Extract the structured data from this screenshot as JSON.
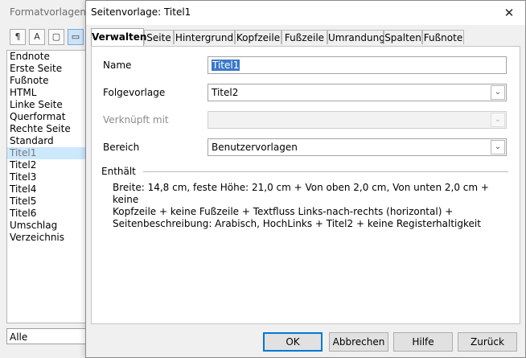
{
  "panel": {
    "title": "Formatvorlagen",
    "items": [
      "Endnote",
      "Erste Seite",
      "Fußnote",
      "HTML",
      "Linke Seite",
      "Querformat",
      "Rechte Seite",
      "Standard",
      "Titel1",
      "Titel2",
      "Titel3",
      "Titel4",
      "Titel5",
      "Titel6",
      "Umschlag",
      "Verzeichnis"
    ],
    "selected_index": 8,
    "filter_value": "Alle"
  },
  "dialog": {
    "title": "Seitenvorlage: Titel1",
    "tabs": [
      "Verwalten",
      "Seite",
      "Hintergrund",
      "Kopfzeile",
      "Fußzeile",
      "Umrandung",
      "Spalten",
      "Fußnote"
    ],
    "active_tab_index": 0,
    "fields": {
      "name_label": "Name",
      "name_value": "Titel1",
      "next_label": "Folgevorlage",
      "next_value": "Titel2",
      "linked_label": "Verknüpft mit",
      "linked_value": "",
      "category_label": "Bereich",
      "category_value": "Benutzervorlagen"
    },
    "contains": {
      "heading": "Enthält",
      "line1": "Breite: 14,8 cm, feste Höhe: 21,0 cm + Von oben 2,0 cm, Von unten 2,0 cm + keine",
      "line2": "Kopfzeile + keine Fußzeile + Textfluss Links-nach-rechts (horizontal) +",
      "line3": "Seitenbeschreibung: Arabisch, HochLinks + Titel2 + keine Registerhaltigkeit"
    },
    "buttons": {
      "ok": "OK",
      "cancel": "Abbrechen",
      "help": "Hilfe",
      "reset": "Zurück"
    }
  },
  "colors": {
    "selection": "#3a78c9",
    "list_highlight": "#cce8ff",
    "default_button_border": "#0078d7"
  },
  "icons": {
    "close": "close-icon",
    "dropdown": "chevron-down-icon"
  }
}
